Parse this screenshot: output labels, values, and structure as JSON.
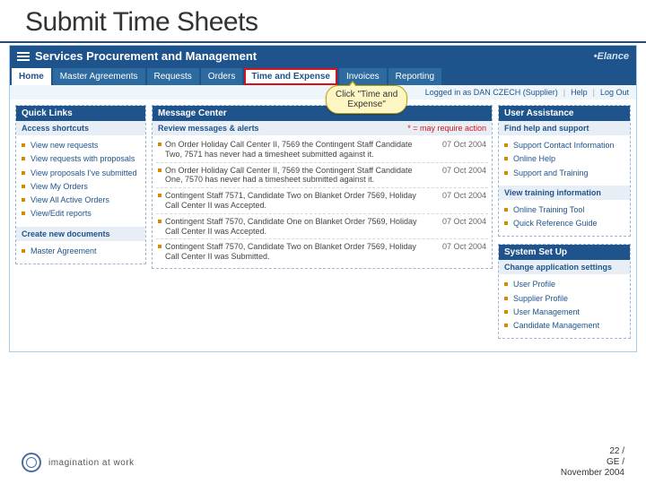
{
  "slide": {
    "title": "Submit Time Sheets"
  },
  "app": {
    "title": "Services Procurement and Management",
    "brand": "•Elance"
  },
  "nav": {
    "items": [
      {
        "label": "Home",
        "active": true
      },
      {
        "label": "Master Agreements"
      },
      {
        "label": "Requests"
      },
      {
        "label": "Orders"
      },
      {
        "label": "Time and Expense",
        "highlight": true
      },
      {
        "label": "Invoices"
      },
      {
        "label": "Reporting"
      }
    ]
  },
  "callout": {
    "text_l1": "Click \"Time and",
    "text_l2": "Expense\""
  },
  "userbar": {
    "logged_as": "Logged in as DAN CZECH (Supplier)",
    "help": "Help",
    "logout": "Log Out"
  },
  "left": {
    "quick_links": {
      "title": "Quick Links",
      "sub": "Access shortcuts",
      "items": [
        "View new requests",
        "View requests with proposals",
        "View proposals I've submitted",
        "View My Orders",
        "View All Active Orders",
        "View/Edit reports"
      ]
    },
    "create": {
      "sub": "Create new documents",
      "items": [
        "Master Agreement"
      ]
    }
  },
  "mid": {
    "title": "Message Center",
    "sub": "Review messages & alerts",
    "req_label": "* = may require action",
    "messages": [
      {
        "text": "On Order Holiday Call Center II, 7569 the Contingent Staff Candidate Two, 7571 has never had a timesheet submitted against it.",
        "date": "07 Oct 2004"
      },
      {
        "text": "On Order Holiday Call Center II, 7569 the Contingent Staff Candidate One, 7570 has never had a timesheet submitted against it.",
        "date": "07 Oct 2004"
      },
      {
        "text": "Contingent Staff 7571, Candidate Two on Blanket Order 7569, Holiday Call Center II was Accepted.",
        "date": "07 Oct 2004"
      },
      {
        "text": "Contingent Staff 7570, Candidate One on Blanket Order 7569, Holiday Call Center II was Accepted.",
        "date": "07 Oct 2004"
      },
      {
        "text": "Contingent Staff 7570, Candidate Two on Blanket Order 7569, Holiday Call Center II was Submitted.",
        "date": "07 Oct 2004"
      }
    ]
  },
  "right": {
    "assist": {
      "title": "User Assistance",
      "sub": "Find help and support",
      "items": [
        "Support Contact Information",
        "Online Help",
        "Support and Training"
      ]
    },
    "training": {
      "sub": "View training information",
      "items": [
        "Online Training Tool",
        "Quick Reference Guide"
      ]
    },
    "setup": {
      "title": "System Set Up",
      "sub": "Change application settings",
      "items": [
        "User Profile",
        "Supplier Profile",
        "User Management",
        "Candidate Management"
      ]
    }
  },
  "footer": {
    "tagline": "imagination at work",
    "page": "22 /",
    "owner": "GE /",
    "date": "November 2004"
  }
}
